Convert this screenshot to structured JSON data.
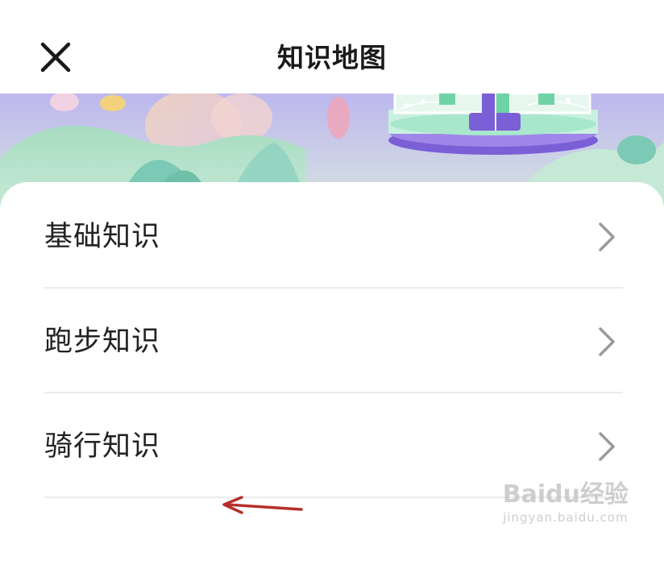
{
  "header": {
    "title": "知识地图",
    "close_icon": "close-icon"
  },
  "banner": {
    "image": "illustration-garden-stage"
  },
  "menu": {
    "items": [
      {
        "label": "基础知识",
        "icon": "chevron-right-icon"
      },
      {
        "label": "跑步知识",
        "icon": "chevron-right-icon"
      },
      {
        "label": "骑行知识",
        "icon": "chevron-right-icon"
      }
    ]
  },
  "overlay": {
    "arrow_color": "#b5302a",
    "watermark_main": "Baidu经验",
    "watermark_sub": "jingyan.baidu.com"
  },
  "colors": {
    "title": "#1a1a1a",
    "divider": "#ececec",
    "chevron": "#9a9a9a",
    "banner_bg": "#cbc7ef",
    "accent_purple": "#7b5fd6",
    "accent_green": "#8fd9b6"
  }
}
